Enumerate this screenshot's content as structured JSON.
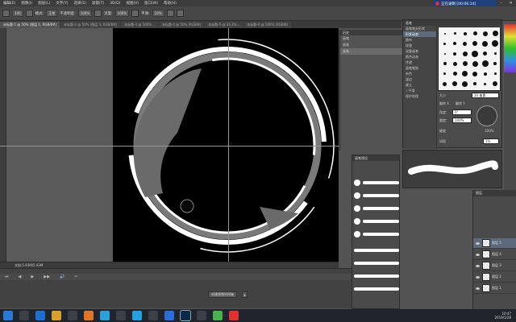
{
  "menubar": {
    "items": [
      "编辑(E)",
      "图像(I)",
      "图层(L)",
      "文字(Y)",
      "选择(S)",
      "滤镜(T)",
      "3D(D)",
      "视图(V)",
      "窗口(W)",
      "帮助(H)"
    ]
  },
  "recorder": {
    "label": "正在录制 [00:06:14]"
  },
  "options": {
    "mode_label": "模式:",
    "mode_value": "正常",
    "opacity_label": "不透明度:",
    "opacity_value": "100%",
    "flow_label": "流量:",
    "flow_value": "100%",
    "smoothing_label": "平滑:",
    "smoothing_value": "10%",
    "brush_size": "100"
  },
  "tabs": [
    "未标题-1 @ 50% (图层 1, RGB/8#)",
    "未标题-2 @ 50% (图层 3, RGB/8#)",
    "未标题-3 @ 100%...",
    "未标题-4 @ 50% (RGB/8)",
    "未标题-5 @ 33.3%...",
    "未标题-6 @ 100% (RGB/8)"
  ],
  "status": {
    "doc_info": "文档:5.93M/5.93M"
  },
  "timeline": {
    "create_video_label": "创建视频时间轴",
    "controls": [
      "⏮",
      "◀",
      "▶",
      "▶▶",
      "🔊",
      "✂"
    ]
  },
  "history": {
    "title": "历史",
    "rows": [
      "画笔",
      "画笔",
      "画笔"
    ]
  },
  "brush_panel": {
    "title": "画笔",
    "list": [
      "画笔笔尖形状",
      "形状动态",
      "散布",
      "纹理",
      "双重画笔",
      "颜色动态",
      "传递",
      "画笔笔势",
      "杂色",
      "湿边",
      "建立",
      "平滑",
      "保护纹理"
    ],
    "checked": [
      false,
      false,
      false,
      false,
      false,
      false,
      false,
      false,
      false,
      false,
      false,
      true,
      false
    ],
    "size_label": "大小",
    "size_value": "30 像素",
    "flip_x_label": "翻转 X",
    "flip_y_label": "翻转 Y",
    "angle_label": "角度:",
    "angle_value": "0°",
    "roundness_label": "圆度:",
    "roundness_value": "100%",
    "hardness_label": "硬度",
    "hardness_value": "100%",
    "spacing_label": "间距",
    "spacing_value": "1%"
  },
  "presets": {
    "title": "画笔预设",
    "size_label": "大小:"
  },
  "layers": {
    "title": "图层",
    "rows": [
      "图层 5",
      "图层 4",
      "图层 3",
      "图层 2",
      "图层 1"
    ],
    "selected_index": 0
  },
  "taskbar": {
    "time": "10:47",
    "date": "2019/1/28"
  }
}
